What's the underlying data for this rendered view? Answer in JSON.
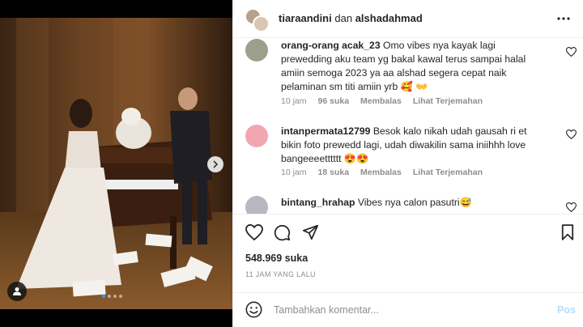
{
  "header": {
    "user1": "tiaraandini",
    "connector": "dan",
    "user2": "alshadahmad"
  },
  "comments": [
    {
      "username": "orang-orang acak_23",
      "text": "Omo vibes nya kayak lagi prewedding aku team yg bakal kawal terus sampai halal amiin semoga 2023 ya aa alshad segera cepat naik pelaminan sm titi amiin yrb 🥰 👐",
      "time": "10 jam",
      "likes": "96 suka",
      "reply": "Membalas",
      "translate": "Lihat Terjemahan"
    },
    {
      "username": "intanpermata12799",
      "text": "Besok kalo nikah udah gausah ri et bikin foto prewedd lagi, udah diwakilin sama iniihhh love bangeeeetttttt 😍😍",
      "time": "10 jam",
      "likes": "18 suka",
      "reply": "Membalas",
      "translate": "Lihat Terjemahan"
    },
    {
      "username": "bintang_hrahap",
      "text": "Vibes nya calon pasutri😅"
    }
  ],
  "post": {
    "likes": "548.969 suka",
    "time_ago": "11 JAM YANG LALU"
  },
  "add_comment": {
    "placeholder": "Tambahkan komentar...",
    "post_label": "Pos"
  },
  "colors": {
    "accent": "#3897f0",
    "post_disabled": "#b2dffc",
    "muted": "#8e8e8e"
  }
}
